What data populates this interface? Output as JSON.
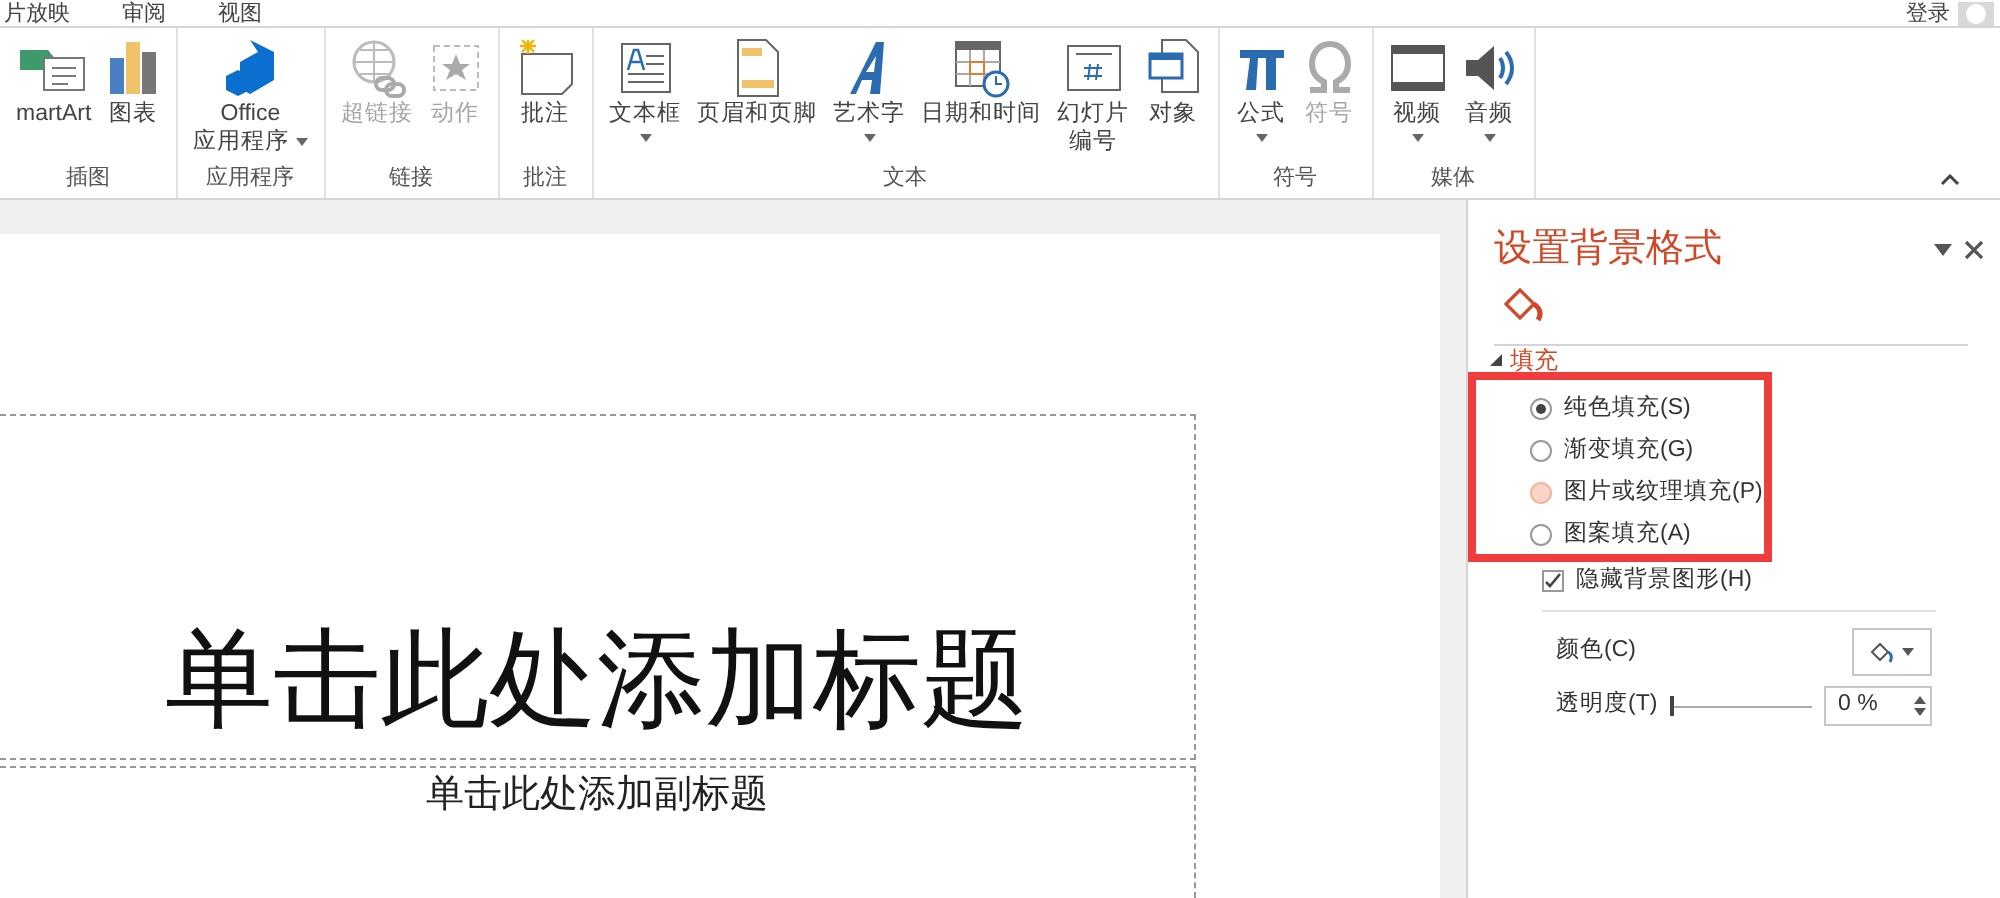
{
  "tabs": [
    {
      "label": "片放映"
    },
    {
      "label": "审阅"
    },
    {
      "label": "视图"
    }
  ],
  "account": {
    "label": "登录"
  },
  "ribbon": {
    "groups": [
      {
        "label": "插图",
        "commands": [
          {
            "lines": [
              "martArt"
            ],
            "kind": "smartart",
            "disabled": false,
            "dropdown": false
          },
          {
            "lines": [
              "图表"
            ],
            "kind": "chart",
            "disabled": false,
            "dropdown": false
          }
        ]
      },
      {
        "label": "应用程序",
        "commands": [
          {
            "lines": [
              "Office",
              "应用程序"
            ],
            "kind": "office",
            "disabled": false,
            "dropdown": true
          }
        ]
      },
      {
        "label": "链接",
        "commands": [
          {
            "lines": [
              "超链接"
            ],
            "kind": "link",
            "disabled": true,
            "dropdown": false
          },
          {
            "lines": [
              "动作"
            ],
            "kind": "action",
            "disabled": true,
            "dropdown": false
          }
        ]
      },
      {
        "label": "批注",
        "commands": [
          {
            "lines": [
              "批注"
            ],
            "kind": "comment",
            "disabled": false,
            "dropdown": false
          }
        ]
      },
      {
        "label": "文本",
        "commands": [
          {
            "lines": [
              "文本框"
            ],
            "kind": "textbox",
            "disabled": false,
            "dropdown": true
          },
          {
            "lines": [
              "页眉和页脚"
            ],
            "kind": "header",
            "disabled": false,
            "dropdown": false
          },
          {
            "lines": [
              "艺术字"
            ],
            "kind": "wordart",
            "disabled": false,
            "dropdown": true
          },
          {
            "lines": [
              "日期和时间"
            ],
            "kind": "datetime",
            "disabled": false,
            "dropdown": false
          },
          {
            "lines": [
              "幻灯片",
              "编号"
            ],
            "kind": "slidenumber",
            "disabled": false,
            "dropdown": false
          },
          {
            "lines": [
              "对象"
            ],
            "kind": "object",
            "disabled": false,
            "dropdown": false
          }
        ]
      },
      {
        "label": "符号",
        "commands": [
          {
            "lines": [
              "公式"
            ],
            "kind": "equation",
            "disabled": false,
            "dropdown": true
          },
          {
            "lines": [
              "符号"
            ],
            "kind": "symbol",
            "disabled": true,
            "dropdown": false
          }
        ]
      },
      {
        "label": "媒体",
        "commands": [
          {
            "lines": [
              "视频"
            ],
            "kind": "video",
            "disabled": false,
            "dropdown": true
          },
          {
            "lines": [
              "音频"
            ],
            "kind": "audio",
            "disabled": false,
            "dropdown": true
          }
        ]
      }
    ]
  },
  "slide": {
    "title_placeholder": "单击此处添加标题",
    "subtitle_placeholder": "单击此处添加副标题"
  },
  "panel": {
    "title": "设置背景格式",
    "section": {
      "label": "填充",
      "expanded": true
    },
    "fill_options": [
      {
        "label": "纯色填充(S)",
        "selected": true,
        "hovered": false
      },
      {
        "label": "渐变填充(G)",
        "selected": false,
        "hovered": false
      },
      {
        "label": "图片或纹理填充(P)",
        "selected": false,
        "hovered": true
      },
      {
        "label": "图案填充(A)",
        "selected": false,
        "hovered": false
      }
    ],
    "hide_background": {
      "label": "隐藏背景图形(H)",
      "checked": true
    },
    "color": {
      "label": "颜色(C)"
    },
    "transparency": {
      "label": "透明度(T)",
      "level": 0,
      "value": "0 %"
    }
  }
}
